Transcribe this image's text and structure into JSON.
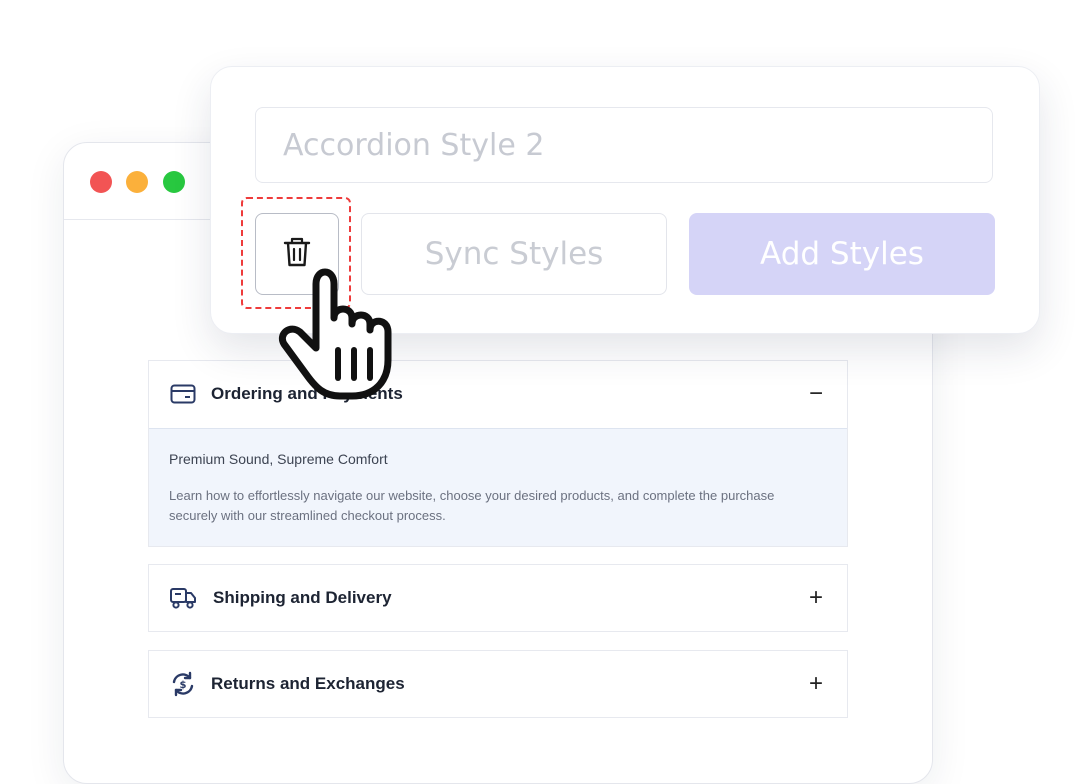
{
  "window": {
    "controls": [
      "close",
      "minimize",
      "maximize"
    ],
    "colors": {
      "close": "#f25454",
      "minimize": "#fbb03b",
      "maximize": "#28c840"
    }
  },
  "style_card": {
    "name_input_value": "Accordion Style 2",
    "delete_icon": "trash-icon",
    "sync_label": "Sync Styles",
    "add_label": "Add Styles",
    "add_color": "#d5d4f7"
  },
  "accordion": {
    "items": [
      {
        "icon": "credit-card-icon",
        "title": "Ordering and Payments",
        "expanded": true,
        "toggle": "−",
        "subtitle": "Premium Sound, Supreme Comfort",
        "body": "Learn how to effortlessly navigate our website, choose your desired products, and complete the purchase securely with our streamlined checkout process."
      },
      {
        "icon": "delivery-truck-icon",
        "title": "Shipping and Delivery",
        "expanded": false,
        "toggle": "+"
      },
      {
        "icon": "exchange-icon",
        "title": "Returns and Exchanges",
        "expanded": false,
        "toggle": "+"
      }
    ]
  },
  "cursor": "hand-pointer-icon"
}
